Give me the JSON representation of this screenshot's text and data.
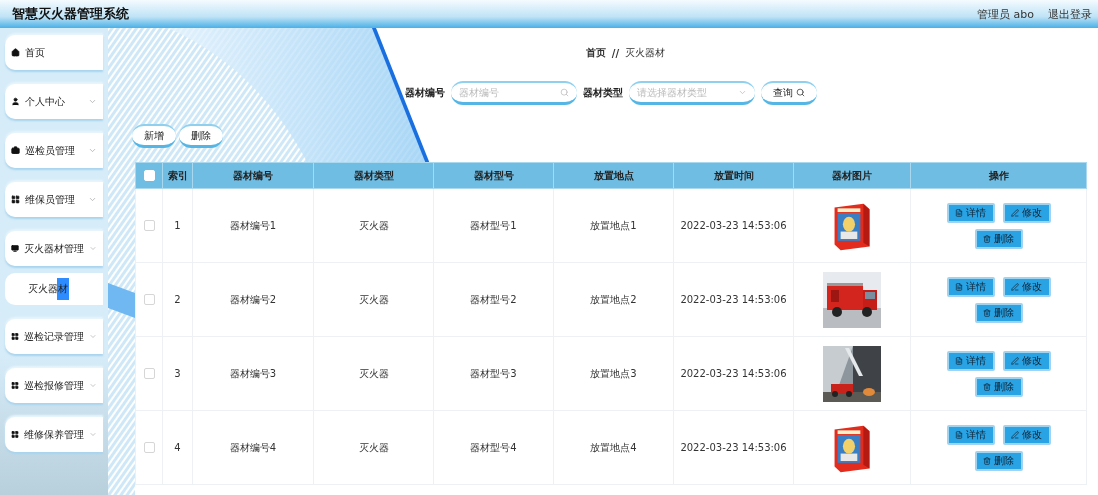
{
  "header": {
    "title": "智慧灭火器管理系统",
    "user": "管理员 abo",
    "logout": "退出登录"
  },
  "sidebar": {
    "items": [
      {
        "label": "首页",
        "selected": false
      },
      {
        "label": "个人中心",
        "selected": false
      },
      {
        "label": "巡检员管理",
        "selected": false
      },
      {
        "label": "维保员管理",
        "selected": false
      },
      {
        "label": "灭火器材管理",
        "selected": false,
        "children": [
          {
            "label": "灭火器材",
            "selected": true
          }
        ]
      },
      {
        "label": "巡检记录管理",
        "selected": false
      },
      {
        "label": "巡检报修管理",
        "selected": false
      },
      {
        "label": "维修保养管理",
        "selected": false
      }
    ]
  },
  "breadcrumb": [
    "首页",
    "//",
    "灭火器材"
  ],
  "search": {
    "code_label": "器材编号",
    "code_placeholder": "器材编号",
    "type_label": "器材类型",
    "type_placeholder": "请选择器材类型",
    "query_button": "查询"
  },
  "toolbar": [
    "新增",
    "删除"
  ],
  "table": {
    "all_checked": false,
    "columns": [
      "索引",
      "器材编号",
      "器材类型",
      "器材型号",
      "放置地点",
      "放置时间",
      "器材图片",
      "操作"
    ],
    "rows": [
      {
        "checked": false,
        "cells": [
          "1",
          "器材编号1",
          "灭火器",
          "器材型号1",
          "放置地点1",
          "2022-03-23 14:53:06"
        ],
        "image": {
          "kind": "picture"
        },
        "actions": [
          "详情",
          "修改",
          "删除"
        ]
      },
      {
        "checked": false,
        "cells": [
          "2",
          "器材编号2",
          "灭火器",
          "器材型号2",
          "放置地点2",
          "2022-03-23 14:53:06"
        ],
        "image": {
          "kind": "picture"
        },
        "actions": [
          "详情",
          "修改",
          "删除"
        ]
      },
      {
        "checked": false,
        "cells": [
          "3",
          "器材编号3",
          "灭火器",
          "器材型号3",
          "放置地点3",
          "2022-03-23 14:53:06"
        ],
        "image": {
          "kind": "picture"
        },
        "actions": [
          "详情",
          "修改",
          "删除"
        ]
      },
      {
        "checked": false,
        "cells": [
          "4",
          "器材编号4",
          "灭火器",
          "器材型号4",
          "放置地点4",
          "2022-03-23 14:53:06"
        ],
        "image": {
          "kind": "picture"
        },
        "actions": [
          "详情",
          "修改",
          "删除"
        ]
      }
    ]
  }
}
